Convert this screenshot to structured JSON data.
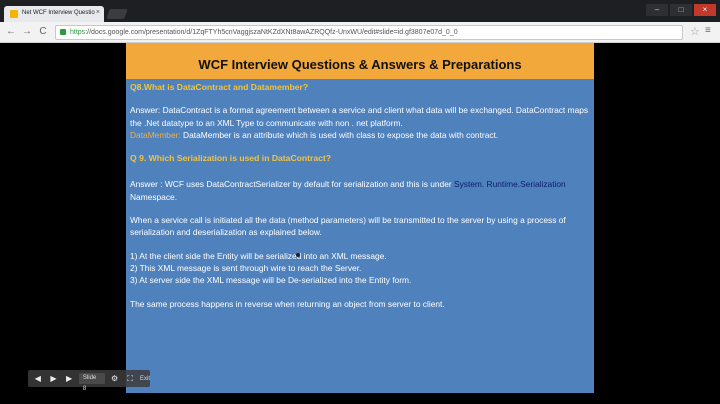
{
  "browser": {
    "tab_title": "Net WCF Interview Questio",
    "url_scheme": "https",
    "url_rest": "://docs.google.com/presentation/d/1ZqFTYh5cnVaggjszaNtKZdXNt8awAZRQQfz-UnxWU/edit#slide=id.gf3807e07d_0_0",
    "tab_close": "×",
    "back": "←",
    "forward": "→",
    "reload": "C",
    "star": "☆",
    "menu": "≡",
    "min": "–",
    "max": "□",
    "close": "×"
  },
  "slide": {
    "title": "WCF Interview Questions & Answers & Preparations",
    "q8": "Q8.What is DataContract and Datamember?",
    "a8_1": "Answer: DataContract is a format agreement between a service and client what data will be exchanged. DataContract maps the .Net datatype to an XML Type to communicate with non . net platform.",
    "dm_label": "DataMember:",
    "dm_text": " DataMember is an attribute which is used with class to expose the data with contract.",
    "q9": "Q 9. Which Serialization is used in DataContract?",
    "a9_pre": "Answer : WCF uses DataContractSerializer by default for serialization and this is under ",
    "a9_ns": "System. Runtime.Serialization",
    "a9_post": " Namespace.",
    "para": "When a service call is initiated all the data (method parameters) will be transmitted to the server by using a process of serialization and deserialization as explained below.",
    "step1": "1) At the client side the Entity will be serialized into an XML message.",
    "step2": "2) This XML message is sent through wire to reach the Server.",
    "step3": "3) At server side the XML message will be De-serialized into the Entity form.",
    "closing": "The same process happens in reverse when returning an object from server to client."
  },
  "controls": {
    "prev": "◀",
    "play": "▶",
    "next": "▶",
    "slide_select": "Slide 8",
    "settings": "⚙",
    "fullscreen": "⛶",
    "exit": "Exit"
  }
}
